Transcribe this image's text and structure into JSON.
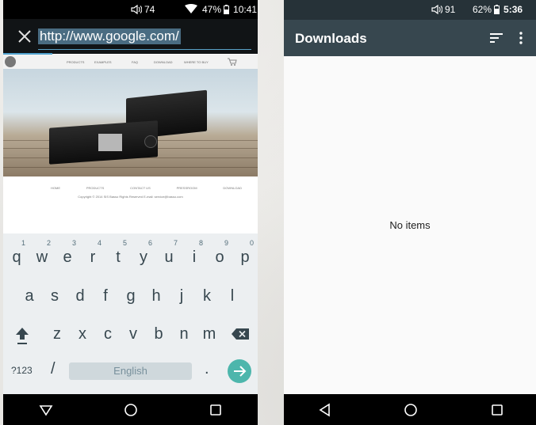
{
  "left_screen": {
    "status": {
      "volume": "74",
      "battery": "47%",
      "time": "10:41"
    },
    "url_value": "http://www.google.com/",
    "webpage": {
      "nav_items": [
        "PRODUCTS",
        "EXAMPLES",
        "FAQ",
        "DOWNLOAD",
        "WHERE TO BUY"
      ],
      "footer_links": [
        "HOME",
        "PRODUCTS",
        "CONTACT US",
        "PRESSROOM",
        "DOWNLOAD"
      ],
      "copyright": "Copyright © 2014 SIS Basso Rights Reserved  E-mail: service@basso.com"
    },
    "keyboard": {
      "row1": [
        {
          "key": "q",
          "hint": "1"
        },
        {
          "key": "w",
          "hint": "2"
        },
        {
          "key": "e",
          "hint": "3"
        },
        {
          "key": "r",
          "hint": "4"
        },
        {
          "key": "t",
          "hint": "5"
        },
        {
          "key": "y",
          "hint": "6"
        },
        {
          "key": "u",
          "hint": "7"
        },
        {
          "key": "i",
          "hint": "8"
        },
        {
          "key": "o",
          "hint": "9"
        },
        {
          "key": "p",
          "hint": "0"
        }
      ],
      "row2": [
        "a",
        "s",
        "d",
        "f",
        "g",
        "h",
        "j",
        "k",
        "l"
      ],
      "row3": [
        "z",
        "x",
        "c",
        "v",
        "b",
        "n",
        "m"
      ],
      "symbols": "?123",
      "slash": "/",
      "space": "English",
      "period": "."
    }
  },
  "right_screen": {
    "status": {
      "volume": "91",
      "battery": "62%",
      "time": "5:36"
    },
    "app_title": "Downloads",
    "empty_text": "No items"
  },
  "colors": {
    "accent_go": "#4db6ac",
    "url_highlight": "#4a6c82",
    "appbar": "#37474f",
    "statusbar_right": "#263238"
  },
  "icons": [
    "volume-icon",
    "wifi-icon",
    "battery-icon",
    "close-icon",
    "shift-icon",
    "backspace-icon",
    "go-arrow-icon",
    "back-icon",
    "home-icon",
    "recents-icon",
    "sort-icon",
    "overflow-menu-icon"
  ]
}
